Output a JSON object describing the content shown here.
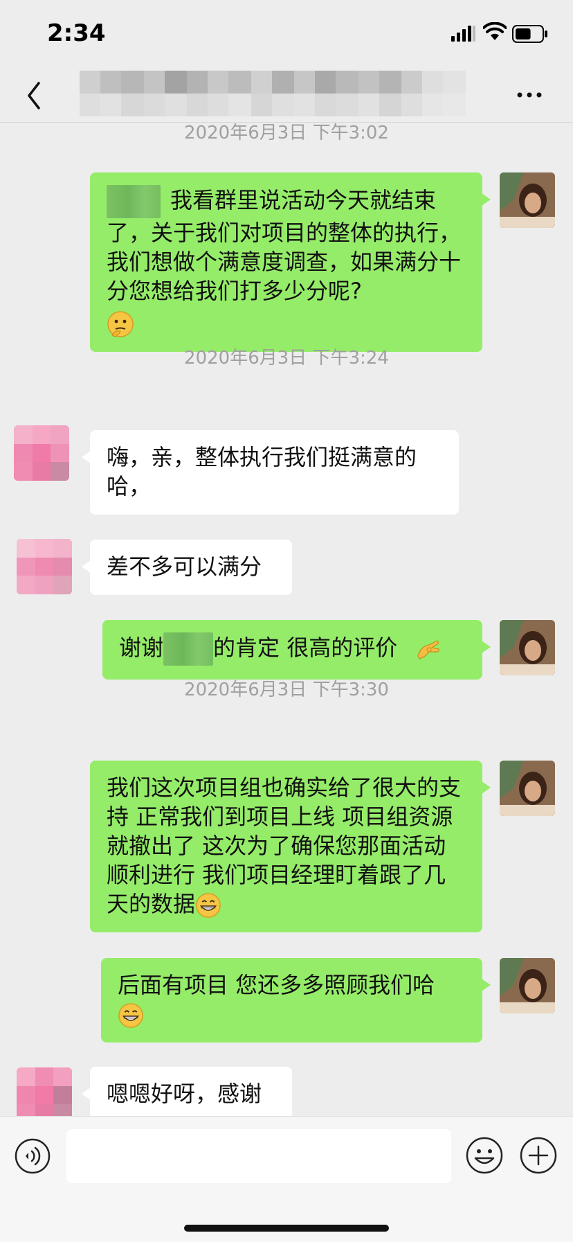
{
  "status_bar": {
    "time": "2:34",
    "battery_level": 0.6
  },
  "nav": {
    "back_icon": "chevron-left-icon",
    "more_icon": "ellipsis-icon"
  },
  "colors": {
    "bubble_out": "#95ec69",
    "bubble_in": "#ffffff",
    "background": "#ededed",
    "timestamp": "#a0a0a0"
  },
  "messages": [
    {
      "timestamp": "2020年6月3日 下午3:02"
    },
    {
      "direction": "out",
      "text": "我看群里说活动今天就结束了，关于我们对项目的整体的执行，我们想做个满意度调查，如果满分十分您想给我们打多少分呢?",
      "emoji": "thinking-face-icon"
    },
    {
      "timestamp": "2020年6月3日 下午3:24"
    },
    {
      "direction": "in",
      "text": "嗨，亲，整体执行我们挺满意的哈，"
    },
    {
      "direction": "in",
      "text": "差不多可以满分"
    },
    {
      "direction": "out",
      "text_before": "谢谢",
      "text_after": "的肯定   很高的评价",
      "emoji": "ok-hand-icon"
    },
    {
      "timestamp": "2020年6月3日 下午3:30"
    },
    {
      "direction": "out",
      "text": "我们这次项目组也确实给了很大的支持   正常我们到项目上线  项目组资源就撤出了    这次为了确保您那面活动顺利进行  我们项目经理盯着跟了几天的数据",
      "emoji": "grinning-face-icon"
    },
    {
      "direction": "out",
      "text": "后面有项目  您还多多照顾我们哈",
      "emoji": "grinning-face-icon"
    },
    {
      "direction": "in",
      "text": "嗯嗯好呀，感谢"
    }
  ],
  "input_bar": {
    "placeholder": "",
    "voice_icon": "voice-icon",
    "emoji_icon": "smiley-icon",
    "plus_icon": "plus-icon"
  }
}
